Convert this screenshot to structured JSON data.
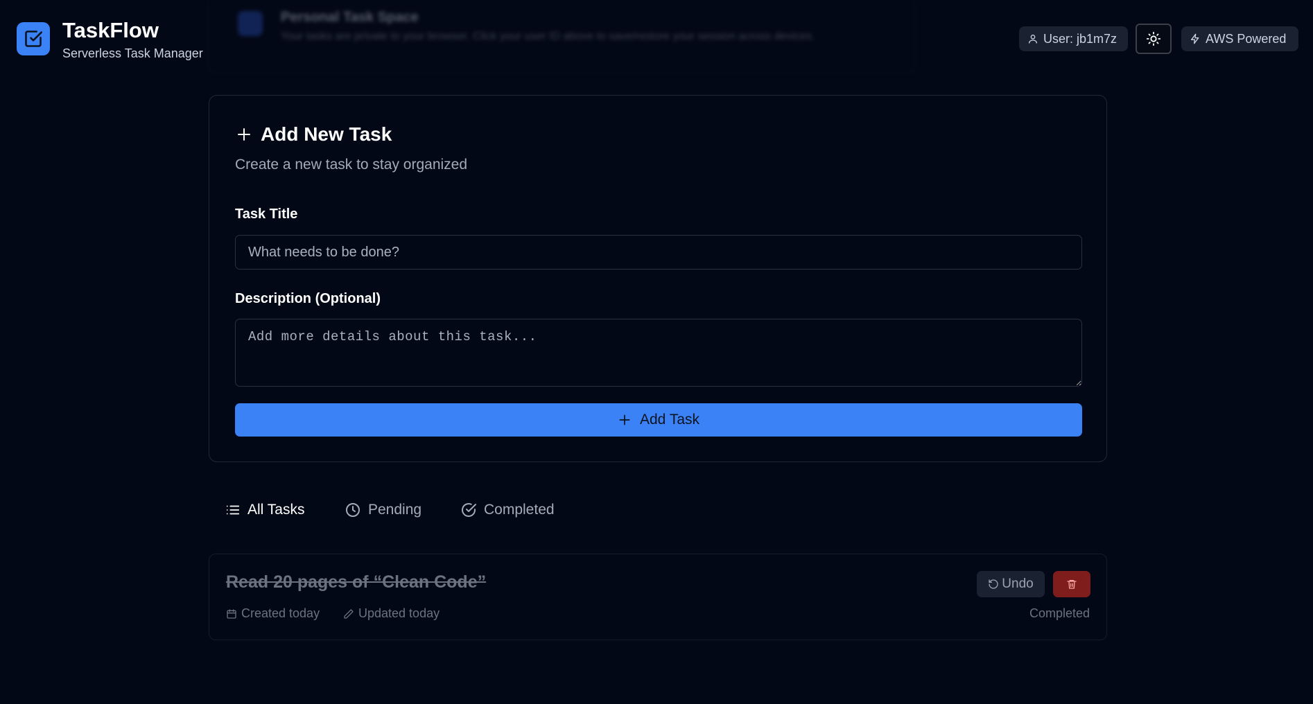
{
  "header": {
    "app_title": "TaskFlow",
    "app_subtitle": "Serverless Task Manager",
    "banner_title": "Personal Task Space",
    "banner_desc": "Your tasks are private to your browser. Click your user ID above to save/restore your session across devices.",
    "user_label": "User: jb1m7z",
    "aws_label": "AWS Powered"
  },
  "form": {
    "title": "Add New Task",
    "subtitle": "Create a new task to stay organized",
    "title_label": "Task Title",
    "title_placeholder": "What needs to be done?",
    "desc_label": "Description (Optional)",
    "desc_placeholder": "Add more details about this task...",
    "submit_label": "Add Task"
  },
  "tabs": [
    {
      "label": "All Tasks",
      "active": true
    },
    {
      "label": "Pending",
      "active": false
    },
    {
      "label": "Completed",
      "active": false
    }
  ],
  "tasks": [
    {
      "title": "Read 20 pages of “Clean Code”",
      "created": "Created today",
      "updated": "Updated today",
      "status": "Completed",
      "undo_label": "Undo"
    }
  ],
  "colors": {
    "accent": "#3b82f6",
    "background": "#030816",
    "danger": "#7f1d1d"
  }
}
